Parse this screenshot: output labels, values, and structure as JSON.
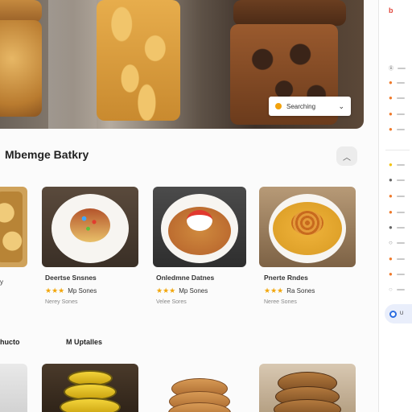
{
  "dropdown": {
    "label": "Searching"
  },
  "page": {
    "title": "Mbemge Batkry"
  },
  "cards": [
    {
      "name": "",
      "rating_text": "y",
      "sub": ""
    },
    {
      "name": "Deertse Snsnes",
      "rating_text": "Mp Sones",
      "sub": "Nerey Sones"
    },
    {
      "name": "Onledmne Datnes",
      "rating_text": "Mp Sones",
      "sub": "Velee Sores"
    },
    {
      "name": "Pnerte Rndes",
      "rating_text": "Ra Sones",
      "sub": "Neree Sones"
    }
  ],
  "stars": "★★★",
  "sections": {
    "left": "hucto",
    "right": "M Uptalles"
  },
  "sidebar": {
    "logo": "b",
    "items": [
      "Ⓑ",
      "●",
      "●",
      "●",
      "●",
      "●",
      "●",
      "●",
      "●",
      "●",
      "○",
      "●",
      "●",
      "○"
    ],
    "button_label": "U"
  },
  "colors": {
    "accent": "#f2a60c",
    "sidebar_dot": "#ef7a2b",
    "blue": "#2b6de0"
  }
}
